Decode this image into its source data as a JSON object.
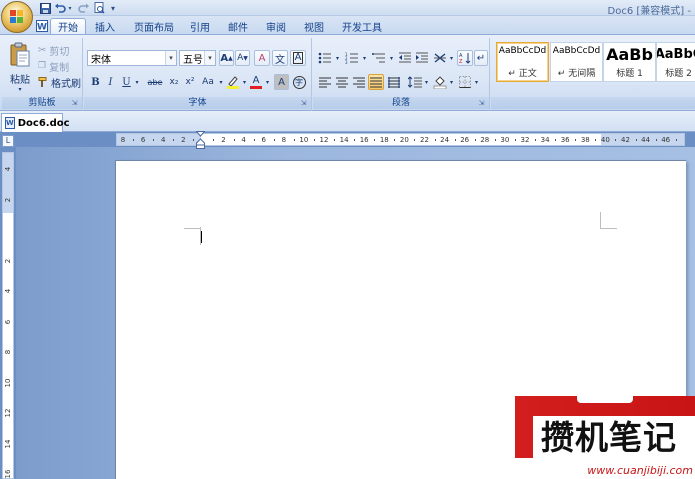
{
  "title_bar": {
    "window_title": "Doc6 [兼容模式] -",
    "qat_icons": [
      "save-icon",
      "undo-icon",
      "redo-icon",
      "print-preview-icon",
      "customize-qat-icon"
    ]
  },
  "tabs": [
    {
      "label": "开始",
      "active": true
    },
    {
      "label": "插入"
    },
    {
      "label": "页面布局"
    },
    {
      "label": "引用"
    },
    {
      "label": "邮件"
    },
    {
      "label": "审阅"
    },
    {
      "label": "视图"
    },
    {
      "label": "开发工具"
    }
  ],
  "ribbon": {
    "clipboard": {
      "label": "剪贴板",
      "paste_label": "粘贴",
      "cut_label": "剪切",
      "copy_label": "复制",
      "format_painter_label": "格式刷"
    },
    "font": {
      "label": "字体",
      "font_name": "宋体",
      "font_size": "五号",
      "bold": "B",
      "italic": "I",
      "underline": "U",
      "strike": "abe",
      "subscript": "x₂",
      "superscript": "x²",
      "change_case": "Aa",
      "grow": "A",
      "shrink": "A",
      "clear": "A",
      "phonetic": "文",
      "border_char": "A",
      "font_color": "A",
      "char_shading": "A",
      "enclose": "字"
    },
    "paragraph": {
      "label": "段落"
    },
    "styles": {
      "cards": [
        {
          "sample": "AaBbCcDd",
          "name": "↵ 正文",
          "selected": true
        },
        {
          "sample": "AaBbCcDd",
          "name": "↵ 无间隔"
        },
        {
          "sample": "AaBb",
          "name": "标题 1"
        },
        {
          "sample": "AaBbC",
          "name": "标题 2"
        }
      ]
    }
  },
  "document": {
    "tab_label": "Doc6.doc",
    "tab_icon": "W"
  },
  "ruler": {
    "corner_glyph": "L",
    "h_labels": [
      "8",
      "6",
      "4",
      "2",
      "",
      "2",
      "4",
      "6",
      "8",
      "10",
      "12",
      "14",
      "16",
      "18",
      "20",
      "22",
      "24",
      "26",
      "28",
      "30",
      "32",
      "34",
      "36",
      "38",
      "40",
      "42",
      "44",
      "46",
      "48"
    ],
    "v_labels": [
      "4",
      "2",
      "",
      "2",
      "4",
      "6",
      "8",
      "10",
      "12",
      "14",
      "16"
    ]
  },
  "watermark": {
    "text": "攒机笔记",
    "url": "www.cuanjibiji.com",
    "red_color": "#c81414"
  }
}
